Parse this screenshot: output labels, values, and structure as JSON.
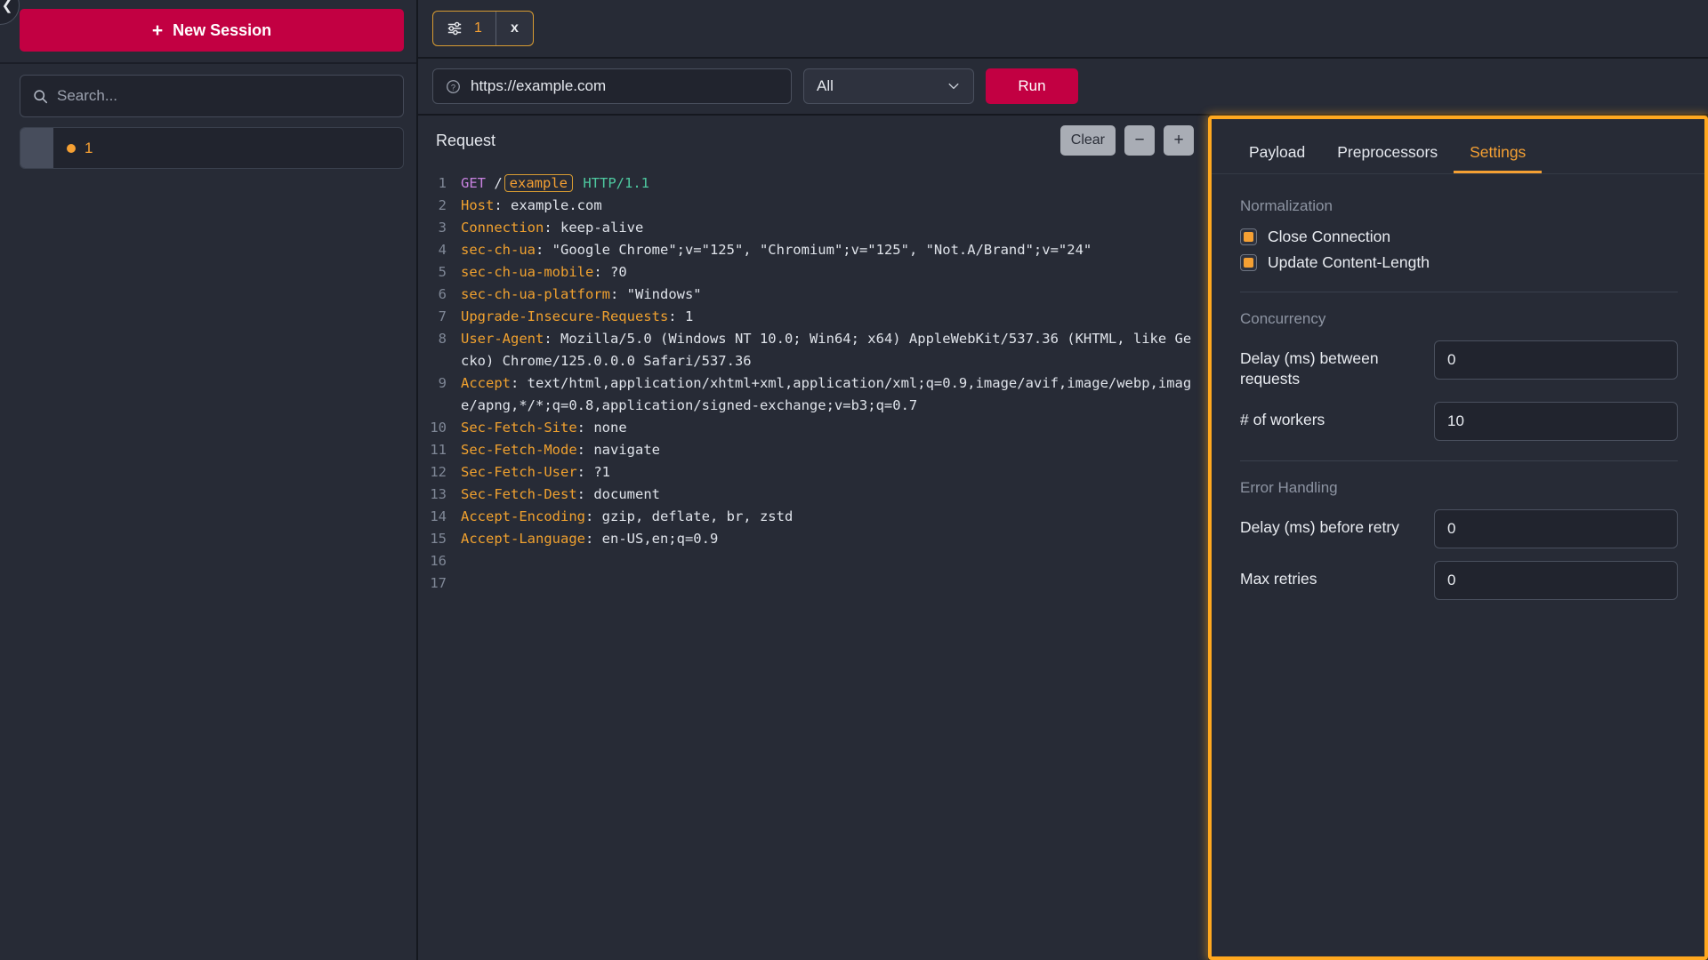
{
  "sidebar": {
    "collapse_icon": "chevron-left-icon",
    "new_session_label": "New Session",
    "new_session_plus": "+",
    "search_placeholder": "Search...",
    "search_value": "",
    "search_icon": "search-icon",
    "sessions": [
      {
        "label": "1",
        "status_dot_color": "#f5a033"
      }
    ]
  },
  "tabbar": {
    "tabs": [
      {
        "icon": "sliders-icon",
        "count": "1",
        "close_label": "x"
      }
    ]
  },
  "urlbar": {
    "help_icon": "question-circle-icon",
    "url_value": "https://example.com",
    "url_placeholder": "https://example.com",
    "scope_value": "All",
    "scope_chevron": "chevron-down-icon",
    "run_label": "Run"
  },
  "request": {
    "title": "Request",
    "clear_label": "Clear",
    "minus_label": "−",
    "plus_label": "+",
    "lines": [
      {
        "n": "1",
        "kind": "request-line",
        "method": "GET",
        "slash": "/",
        "var": "example",
        "proto": "HTTP/1.1"
      },
      {
        "n": "2",
        "kind": "header",
        "name": "Host",
        "value": "example.com"
      },
      {
        "n": "3",
        "kind": "header",
        "name": "Connection",
        "value": "keep-alive"
      },
      {
        "n": "4",
        "kind": "header",
        "name": "sec-ch-ua",
        "value": "\"Google Chrome\";v=\"125\", \"Chromium\";v=\"125\", \"Not.A/Brand\";v=\"24\""
      },
      {
        "n": "5",
        "kind": "header",
        "name": "sec-ch-ua-mobile",
        "value": "?0"
      },
      {
        "n": "6",
        "kind": "header",
        "name": "sec-ch-ua-platform",
        "value": "\"Windows\""
      },
      {
        "n": "7",
        "kind": "header",
        "name": "Upgrade-Insecure-Requests",
        "value": "1"
      },
      {
        "n": "8",
        "kind": "header",
        "name": "User-Agent",
        "value": "Mozilla/5.0 (Windows NT 10.0; Win64; x64) AppleWebKit/537.36 (KHTML, like Gecko) Chrome/125.0.0.0 Safari/537.36"
      },
      {
        "n": "9",
        "kind": "header",
        "name": "Accept",
        "value": "text/html,application/xhtml+xml,application/xml;q=0.9,image/avif,image/webp,image/apng,*/*;q=0.8,application/signed-exchange;v=b3;q=0.7"
      },
      {
        "n": "10",
        "kind": "header",
        "name": "Sec-Fetch-Site",
        "value": "none"
      },
      {
        "n": "11",
        "kind": "header",
        "name": "Sec-Fetch-Mode",
        "value": "navigate"
      },
      {
        "n": "12",
        "kind": "header",
        "name": "Sec-Fetch-User",
        "value": "?1"
      },
      {
        "n": "13",
        "kind": "header",
        "name": "Sec-Fetch-Dest",
        "value": "document"
      },
      {
        "n": "14",
        "kind": "header",
        "name": "Accept-Encoding",
        "value": "gzip, deflate, br, zstd"
      },
      {
        "n": "15",
        "kind": "header",
        "name": "Accept-Language",
        "value": "en-US,en;q=0.9"
      },
      {
        "n": "16",
        "kind": "blank"
      },
      {
        "n": "17",
        "kind": "blank"
      }
    ]
  },
  "settings_panel": {
    "highlight_color": "#ffa81f",
    "tabs": [
      {
        "label": "Payload",
        "active": false
      },
      {
        "label": "Preprocessors",
        "active": false
      },
      {
        "label": "Settings",
        "active": true
      }
    ],
    "normalization": {
      "title": "Normalization",
      "checks": [
        {
          "label": "Close Connection",
          "checked": true
        },
        {
          "label": "Update Content-Length",
          "checked": true
        }
      ]
    },
    "concurrency": {
      "title": "Concurrency",
      "fields": [
        {
          "label": "Delay (ms) between requests",
          "value": "0"
        },
        {
          "label": "# of workers",
          "value": "10"
        }
      ]
    },
    "error_handling": {
      "title": "Error Handling",
      "fields": [
        {
          "label": "Delay (ms) before retry",
          "value": "0"
        },
        {
          "label": "Max retries",
          "value": "0"
        }
      ]
    }
  }
}
